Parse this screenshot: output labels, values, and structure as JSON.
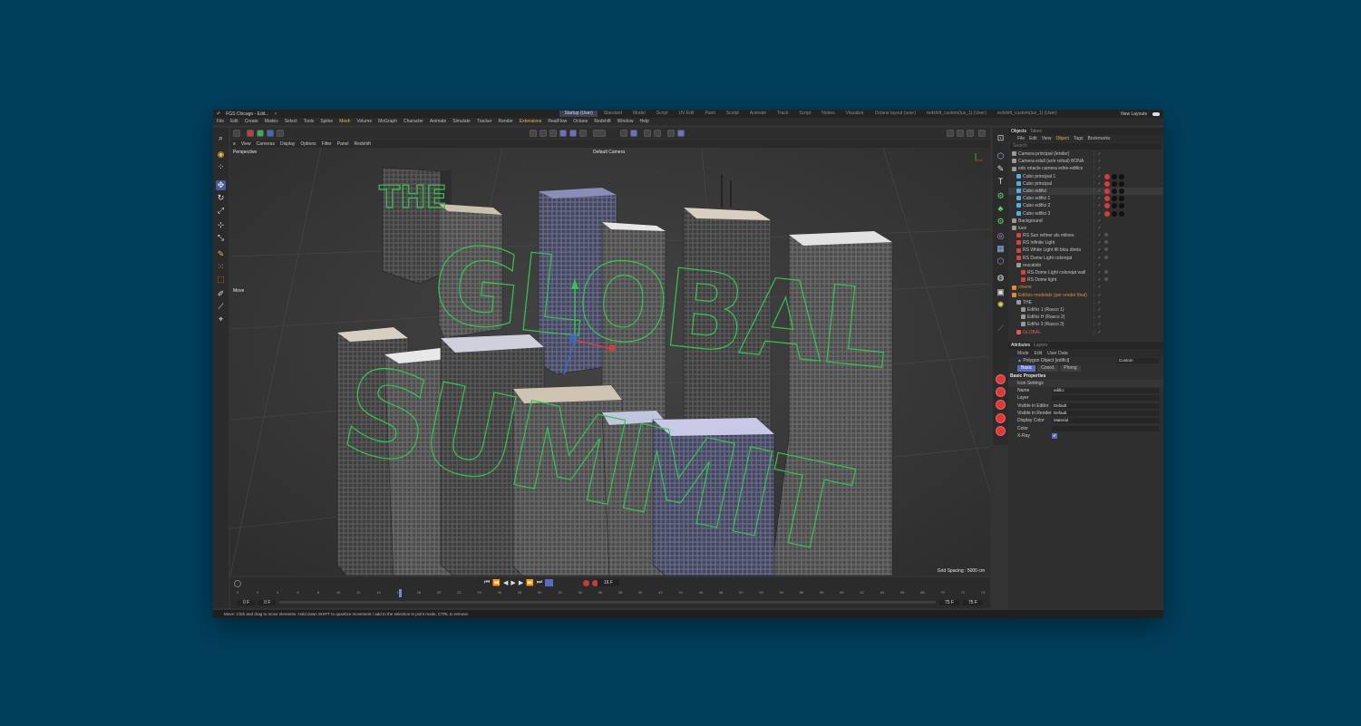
{
  "titlebar": {
    "title": "FGS Chicago - Edit...",
    "layouts": [
      "Startup (User)",
      "Standard",
      "Model",
      "Script",
      "UV Edit",
      "Paint",
      "Sculpt",
      "Animate",
      "Track",
      "Script",
      "Nodes",
      "Visualize",
      "Octane layout (user)",
      "redshift_custom(lux_1) (User)",
      "redshift_custom(lux_1) (User)"
    ],
    "active_layout": "Startup (User)",
    "new_layouts": "New Layouts"
  },
  "menubar": [
    "File",
    "Edit",
    "Create",
    "Modes",
    "Select",
    "Tools",
    "Spline",
    "Mesh",
    "Volume",
    "MoGraph",
    "Character",
    "Animate",
    "Simulate",
    "Tracker",
    "Render",
    "Extensions",
    "RealFlow",
    "Octane",
    "Redshift",
    "Window",
    "Help"
  ],
  "viewport_menu": [
    "View",
    "Cameras",
    "Display",
    "Options",
    "Filter",
    "Panel",
    "Redshift"
  ],
  "viewport": {
    "name": "Perspective",
    "camera": "Default Camera",
    "grid_spacing": "Grid Spacing : 5000 cm",
    "tool_label": "Move"
  },
  "extrude_text": {
    "line1": "THE",
    "line2": "GLOBAL",
    "line3": "SUMMIT"
  },
  "timeline": {
    "ticks": [
      "0",
      "2",
      "4",
      "6",
      "8",
      "10",
      "12",
      "14",
      "16",
      "18",
      "20",
      "22",
      "24",
      "26",
      "28",
      "30",
      "32",
      "34",
      "36",
      "38",
      "40",
      "42",
      "44",
      "46",
      "48",
      "50",
      "52",
      "54",
      "56",
      "58",
      "60",
      "62",
      "64",
      "66",
      "68",
      "70",
      "72",
      "74"
    ],
    "current_frame": "16 F",
    "start": "0 F",
    "start2": "0 F",
    "end": "75 F",
    "end2": "75 F",
    "playhead": 16,
    "max": 75
  },
  "status": "Move: Click and drag to move elements. Hold down SHIFT to quantize movement / add to the selection in point mode, CTRL to remove.",
  "objects": {
    "tabs": [
      "Objects",
      "Takes"
    ],
    "menu": [
      "File",
      "Edit",
      "View",
      "Object",
      "Tags",
      "Bookmarks"
    ],
    "search_placeholder": "Search",
    "rows": [
      {
        "name": "Camera principal (lender)",
        "indent": 0,
        "color": "#9a9a9a"
      },
      {
        "name": "Camera edull (ar/e refsal) BONA",
        "indent": 0,
        "color": "#9a9a9a"
      },
      {
        "name": "edo rotacle camera edrie-edifics",
        "indent": 0,
        "color": "#9a9a9a"
      },
      {
        "name": "Cubo principal 1",
        "indent": 1,
        "color": "#4fb0e8"
      },
      {
        "name": "Cubo principal",
        "indent": 1,
        "color": "#4fb0e8"
      },
      {
        "name": "Cubo edifici",
        "indent": 1,
        "color": "#4fb0e8"
      },
      {
        "name": "Cubo edifici 1",
        "indent": 1,
        "color": "#4fb0e8"
      },
      {
        "name": "Cubo edifici 2",
        "indent": 1,
        "color": "#4fb0e8"
      },
      {
        "name": "Cubo edifici 3",
        "indent": 1,
        "color": "#4fb0e8"
      },
      {
        "name": "Background",
        "indent": 0,
        "color": "#9a9a9a"
      },
      {
        "name": "luce",
        "indent": 0,
        "color": "#9a9a9a"
      },
      {
        "name": "RS Sun refiner als milnes",
        "indent": 1,
        "color": "#d94040"
      },
      {
        "name": "RS Infinite Light",
        "indent": 1,
        "color": "#d94040"
      },
      {
        "name": "RS White Light fill blou direla",
        "indent": 1,
        "color": "#d94040"
      },
      {
        "name": "RS Dome Light colorejat",
        "indent": 1,
        "color": "#d94040"
      },
      {
        "name": "rescatido",
        "indent": 1,
        "color": "#9a9a9a"
      },
      {
        "name": "RS Dome Light colorejat wall",
        "indent": 2,
        "color": "#d94040"
      },
      {
        "name": "RS Dome light",
        "indent": 2,
        "color": "#d94040"
      },
      {
        "name": "cinene",
        "indent": 0,
        "color": "#e08b3a"
      },
      {
        "name": "Edificis modelats (per render final)",
        "indent": 0,
        "color": "#e08b3a"
      },
      {
        "name": "THE",
        "indent": 1,
        "color": "#9a9a9a"
      },
      {
        "name": "Edifici 1 (Rasco 1)",
        "indent": 2,
        "color": "#9a9a9a"
      },
      {
        "name": "Edifici H (Rasco 2)",
        "indent": 2,
        "color": "#9a9a9a"
      },
      {
        "name": "Edifici 3 (Rasco 3)",
        "indent": 2,
        "color": "#9a9a9a"
      },
      {
        "name": "GLOBAL",
        "indent": 1,
        "color": "#e05a5a"
      }
    ]
  },
  "attributes": {
    "tabs": [
      "Attributes",
      "Layers"
    ],
    "menu": [
      "Mode",
      "Edit",
      "User Data"
    ],
    "object": "Polygon Object [edifici]",
    "object_mode": "Custom",
    "basic_tabs": [
      "Basic",
      "Coord.",
      "Phong"
    ],
    "section": "Basic Properties",
    "subsection": "Icon Settings",
    "fields": [
      {
        "label": "Name",
        "value": "edifici"
      },
      {
        "label": "Layer",
        "value": ""
      },
      {
        "label": "Visible in Editor",
        "value": "Default"
      },
      {
        "label": "Visible in Renderer",
        "value": "Default"
      },
      {
        "label": "Display Color",
        "value": "Material"
      },
      {
        "label": "Color",
        "value": ""
      },
      {
        "label": "X-Ray",
        "value": "✔"
      }
    ]
  },
  "colors": {
    "accent": "#6b6fc9",
    "text_green": "#36c450",
    "bg": "#003f5c"
  }
}
